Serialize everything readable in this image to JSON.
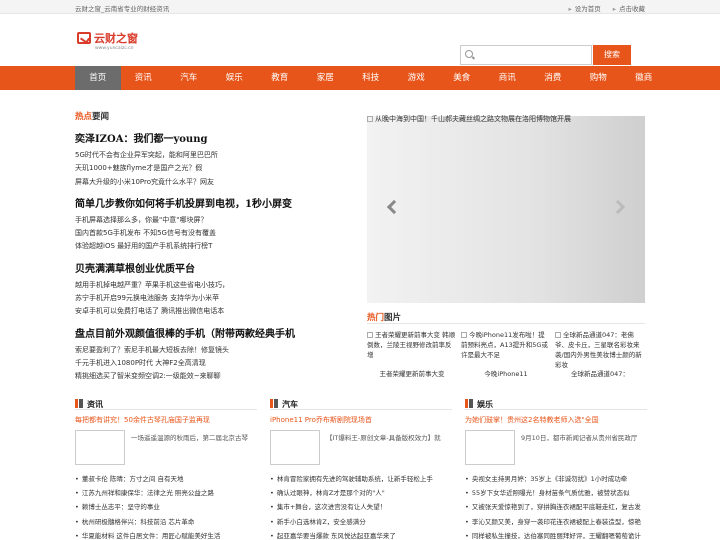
{
  "topbar": {
    "tagline": "云财之窗_云南省专业的财经资讯",
    "set_home": "设为首页",
    "bookmark": "点击收藏"
  },
  "logo": {
    "name": "云财之窗",
    "url": "www.yuncaizc.cn"
  },
  "search": {
    "placeholder": "",
    "button": "搜索"
  },
  "nav": [
    "首页",
    "资讯",
    "汽车",
    "娱乐",
    "教育",
    "家居",
    "科技",
    "游戏",
    "美食",
    "商讯",
    "消费",
    "购物",
    "徽商"
  ],
  "hot": {
    "title_red": "热点",
    "title_rest": "要闻",
    "groups": [
      {
        "headline": "奕泽IZOA：我们都一young",
        "lines": [
          "5G时代不会有企业异军突起，能和阿里巴巴所",
          "天玑1000+魅族flyme才是国产之光？假",
          "屏幕大升级的小米10Pro究竟什么水平？网友"
        ]
      },
      {
        "headline": "简单几步教你如何将手机投屏到电视，1秒小屏变",
        "lines": [
          "手机屏幕选择那么多，你最\"中意\"哪块屏？",
          "国内首款5G手机发布 不知5G信号有没有覆盖",
          "体验超越iOS 最好用的国产手机系统排行榜T"
        ]
      },
      {
        "headline": "贝壳满满草根创业优质平台",
        "lines": [
          "越用手机掉电越严重？苹果手机这些省电小技巧，",
          "苏宁手机开启99元换电池服务 支持华为小米苹",
          "安卓手机可以免费打电话了 腾讯推出微信电话本"
        ]
      },
      {
        "headline": "盘点目前外观颜值很棒的手机（附带两款经典手机",
        "lines": [
          "索尼要盈利了？索尼手机最大短板去除！修复镜头",
          "千元手机进入1080P时代 大神F2全高清现",
          "精挑细选买了智米变频空调2:一级能效~来聊聊"
        ]
      }
    ]
  },
  "slider": {
    "caption": "从晚中海到中国！千山郝夫藏丝绸之路文物展在洛阳博物馆开展"
  },
  "hotpics": {
    "title_red": "热门",
    "title_rest": "图片",
    "items": [
      {
        "alt": "王者荣耀更新前事大变 韩顺倒数，兰陵王视野修改前率反增",
        "caption": "王者荣耀更新前事大变"
      },
      {
        "alt": "今晚iPhone11发布啦！提前预料亮点，A13提升和5G或许是最大不足",
        "caption": "今晚iPhone11"
      },
      {
        "alt": "全球新品通道047：老佛爷、皮卡丘，三星联名彩妆来袭/国内外男性美妆博士颜的新彩妆",
        "caption": "全球新品通道047："
      }
    ]
  },
  "sections": [
    {
      "name": "资讯",
      "lead": "每把都有讲究！50余件古琴孔庙国子监再现",
      "thumb_text": "一场遥遥温源的秋雨后，第二届北京古琴",
      "items": [
        "董叔卡伦 陈晴：方寸之间 自有天地",
        "江苏九州祥和康保华：法律之光 照亮公益之路",
        "赖博士丛志平：坚守的事业",
        "杭州研极髓格伴兴：科技前沿 芯片革命",
        "华夏能材料 这件白居文件：用匠心赋能美好生活"
      ]
    },
    {
      "name": "汽车",
      "lead": "iPhone11 Pro乔布斯剧院现场首",
      "thumb_text": "【IT爆料王-原创文章-具备版权效力】就",
      "items": [
        "林肯冒险家拥有先进的驾驶辅助系统，让新手轻松上手",
        "确认过眼神，林肯Z才是那个对的\"人\"",
        "集市+舞台，这次进宫没有让人失望！",
        "新手小白选林肯Z，安全感满分",
        "起亚嘉华要当爆款 东风悦达起亚嘉华来了"
      ]
    },
    {
      "name": "娱乐",
      "lead": "为她们鼓掌！贵州这2名特教老师入选\"全国",
      "thumb_text": "9月10日，都市新闻记者从贵州省民政厅",
      "items": [
        "央视女主持男月婷：35岁上《非诚勿扰》1小时成功牵",
        "55岁下女华近照曝光！身材苗条气质优雅，被赞状态似",
        "又被张天爱惊艳到了，穿拼胸连衣裙配平底鞋走红，复古发",
        "李沁又颜又美，身穿一袭印花连衣裙被配上春装造型，惊艳",
        "同样被私生撞技，达伯塞同胜丽拜好评，王耀翻嗯葡萄诡计"
      ]
    }
  ]
}
